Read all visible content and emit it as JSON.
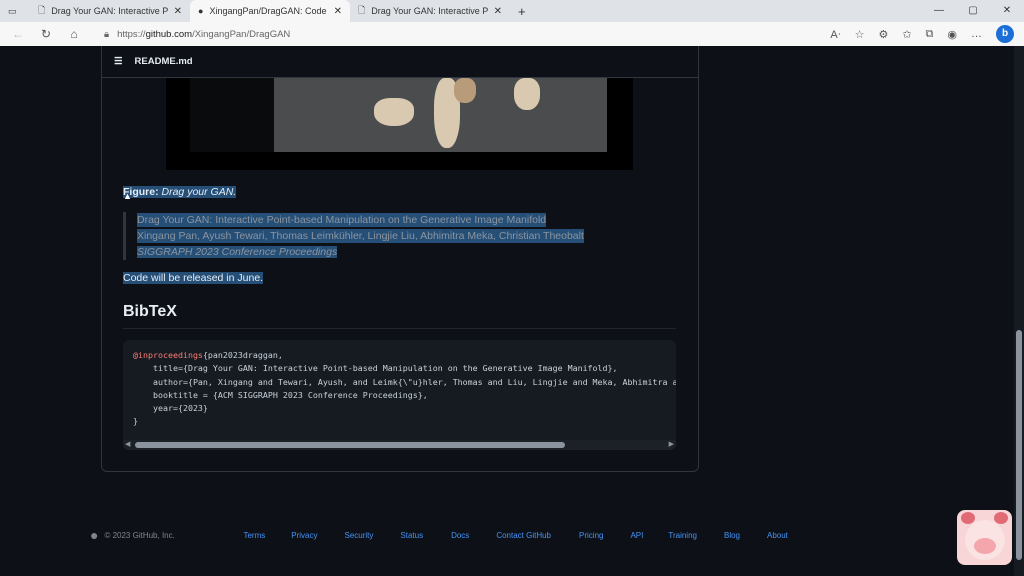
{
  "browser": {
    "tabs": [
      {
        "title": "Drag Your GAN: Interactive Point",
        "icon": "page-icon",
        "active": false
      },
      {
        "title": "XingangPan/DragGAN: Code for",
        "icon": "github-icon",
        "active": true
      },
      {
        "title": "Drag Your GAN: Interactive Point",
        "icon": "page-icon",
        "active": false
      }
    ],
    "url_prefix": "https://",
    "url_domain": "github.com",
    "url_path": "/XingangPan/DragGAN"
  },
  "readme": {
    "filename": "README.md",
    "figure_label": "Figure:",
    "figure_caption": "Drag your GAN.",
    "quote": {
      "title": "Drag Your GAN: Interactive Point-based Manipulation on the Generative Image Manifold",
      "authors": "Xingang Pan, Ayush Tewari, Thomas Leimkühler, Lingjie Liu, Abhimitra Meka, Christian Theobalt",
      "venue": "SIGGRAPH 2023 Conference Proceedings"
    },
    "release_note": "Code will be released in June.",
    "bibtex_heading": "BibTeX",
    "bibtex": {
      "keyword": "@inproceedings",
      "line0": "{pan2023draggan,",
      "lines": [
        "    title={Drag Your GAN: Interactive Point-based Manipulation on the Generative Image Manifold},",
        "    author={Pan, Xingang and Tewari, Ayush, and Leimk{\\\"u}hler, Thomas and Liu, Lingjie and Meka, Abhimitra a",
        "    booktitle = {ACM SIGGRAPH 2023 Conference Proceedings},",
        "    year={2023}",
        "}"
      ]
    }
  },
  "footer": {
    "copyright": "© 2023 GitHub, Inc.",
    "links": [
      "Terms",
      "Privacy",
      "Security",
      "Status",
      "Docs",
      "Contact GitHub",
      "Pricing",
      "API",
      "Training",
      "Blog",
      "About"
    ]
  },
  "colors": {
    "background": "#0d1117",
    "link": "#4493f8",
    "selection": "#264f78"
  }
}
